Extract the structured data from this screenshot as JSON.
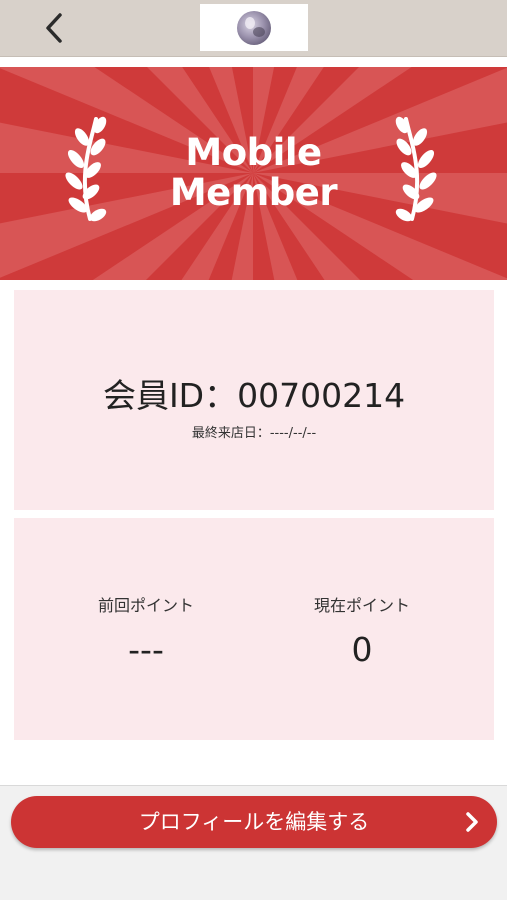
{
  "navbar": {
    "back_icon": "chevron-left-icon",
    "logo_icon": "shop-logo-image"
  },
  "banner": {
    "title_line1": "Mobile",
    "title_line2": "Member",
    "left_icon": "laurel-branch-icon",
    "right_icon": "laurel-branch-icon",
    "background_color": "#cf3a3a"
  },
  "member": {
    "id_label": "会員ID：",
    "id_value": "00700214",
    "last_visit_label": "最終来店日：",
    "last_visit_value": "----/--/--"
  },
  "points": {
    "previous_label": "前回ポイント",
    "previous_value": "---",
    "current_label": "現在ポイント",
    "current_value": "0"
  },
  "actions": {
    "edit_profile_label": "プロフィールを編集する",
    "edit_profile_icon": "chevron-right-icon",
    "button_color": "#cc3434"
  },
  "colors": {
    "panel_background": "#fbe9ec",
    "navbar_background": "#d8d1ca"
  }
}
